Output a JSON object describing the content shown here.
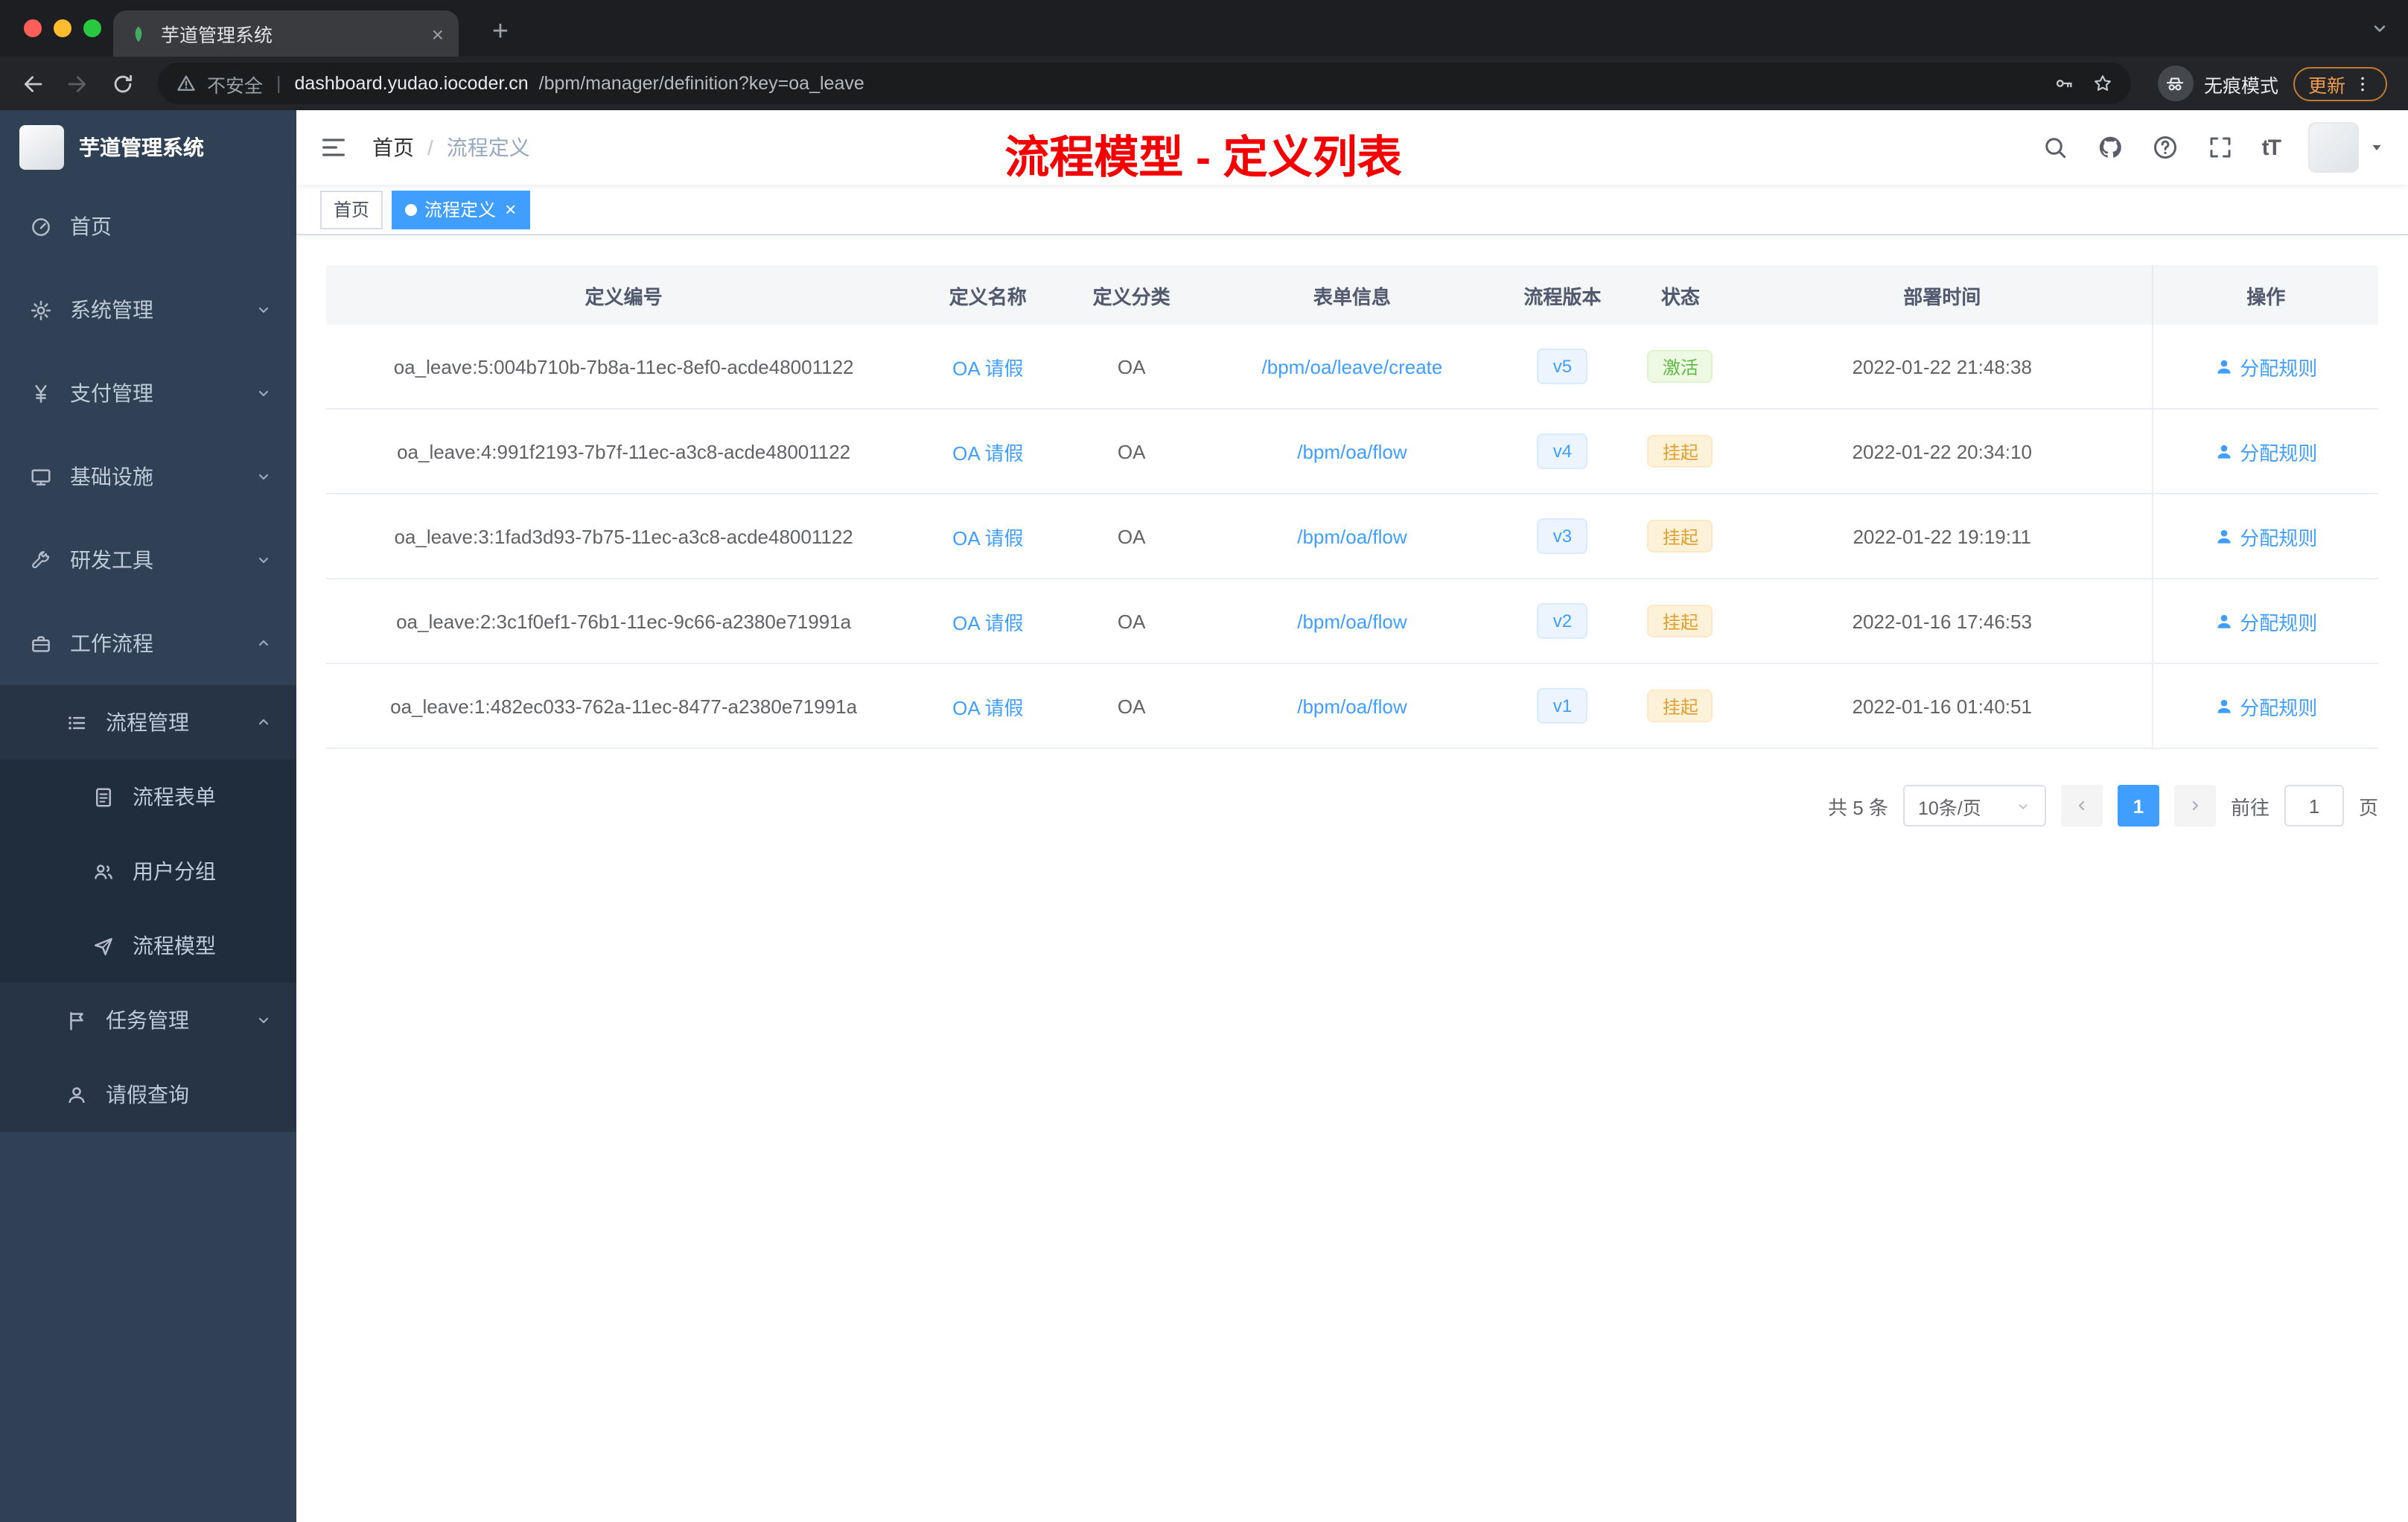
{
  "colors": {
    "accent": "#409eff",
    "success": "#67c23a",
    "warning": "#e6a23c",
    "title_red": "#f40000",
    "sidebar_bg": "#304156"
  },
  "browser": {
    "tab_title": "芋道管理系统",
    "security_text": "不安全",
    "url_domain": "dashboard.yudao.iocoder.cn",
    "url_path": "/bpm/manager/definition?key=oa_leave",
    "incognito_label": "无痕模式",
    "update_label": "更新"
  },
  "sidebar": {
    "logo_title": "芋道管理系统",
    "items": [
      {
        "key": "home",
        "label": "首页",
        "icon": "dashboard-icon",
        "level": 0
      },
      {
        "key": "system",
        "label": "系统管理",
        "icon": "gear-icon",
        "level": 0,
        "arrow": "down"
      },
      {
        "key": "payment",
        "label": "支付管理",
        "icon": "yen-icon",
        "level": 0,
        "arrow": "down"
      },
      {
        "key": "infra",
        "label": "基础设施",
        "icon": "monitor-icon",
        "level": 0,
        "arrow": "down"
      },
      {
        "key": "devtools",
        "label": "研发工具",
        "icon": "tool-icon",
        "level": 0,
        "arrow": "down"
      },
      {
        "key": "workflow",
        "label": "工作流程",
        "icon": "briefcase-icon",
        "level": 0,
        "arrow": "up"
      },
      {
        "key": "process-mgmt",
        "label": "流程管理",
        "icon": "list-icon",
        "level": 1,
        "arrow": "up"
      },
      {
        "key": "process-form",
        "label": "流程表单",
        "icon": "form-icon",
        "level": 2
      },
      {
        "key": "user-group",
        "label": "用户分组",
        "icon": "users-icon",
        "level": 2
      },
      {
        "key": "process-model",
        "label": "流程模型",
        "icon": "send-icon",
        "level": 2
      },
      {
        "key": "task-mgmt",
        "label": "任务管理",
        "icon": "flag-icon",
        "level": 1,
        "arrow": "down"
      },
      {
        "key": "leave-query",
        "label": "请假查询",
        "icon": "user-icon",
        "level": 1
      }
    ]
  },
  "header": {
    "breadcrumb": [
      "首页",
      "流程定义"
    ],
    "page_title": "流程模型 - 定义列表"
  },
  "tags": [
    {
      "label": "首页",
      "active": false,
      "closable": false
    },
    {
      "label": "流程定义",
      "active": true,
      "closable": true
    }
  ],
  "table": {
    "columns": [
      "定义编号",
      "定义名称",
      "定义分类",
      "表单信息",
      "流程版本",
      "状态",
      "部署时间",
      "操作"
    ],
    "rows": [
      {
        "id": "oa_leave:5:004b710b-7b8a-11ec-8ef0-acde48001122",
        "name": "OA 请假",
        "category": "OA",
        "form": "/bpm/oa/leave/create",
        "version": "v5",
        "status": "激活",
        "status_type": "success",
        "deploy_time": "2022-01-22 21:48:38",
        "action": "分配规则"
      },
      {
        "id": "oa_leave:4:991f2193-7b7f-11ec-a3c8-acde48001122",
        "name": "OA 请假",
        "category": "OA",
        "form": "/bpm/oa/flow",
        "version": "v4",
        "status": "挂起",
        "status_type": "warning",
        "deploy_time": "2022-01-22 20:34:10",
        "action": "分配规则"
      },
      {
        "id": "oa_leave:3:1fad3d93-7b75-11ec-a3c8-acde48001122",
        "name": "OA 请假",
        "category": "OA",
        "form": "/bpm/oa/flow",
        "version": "v3",
        "status": "挂起",
        "status_type": "warning",
        "deploy_time": "2022-01-22 19:19:11",
        "action": "分配规则"
      },
      {
        "id": "oa_leave:2:3c1f0ef1-76b1-11ec-9c66-a2380e71991a",
        "name": "OA 请假",
        "category": "OA",
        "form": "/bpm/oa/flow",
        "version": "v2",
        "status": "挂起",
        "status_type": "warning",
        "deploy_time": "2022-01-16 17:46:53",
        "action": "分配规则"
      },
      {
        "id": "oa_leave:1:482ec033-762a-11ec-8477-a2380e71991a",
        "name": "OA 请假",
        "category": "OA",
        "form": "/bpm/oa/flow",
        "version": "v1",
        "status": "挂起",
        "status_type": "warning",
        "deploy_time": "2022-01-16 01:40:51",
        "action": "分配规则"
      }
    ]
  },
  "pagination": {
    "total_text": "共 5 条",
    "page_size": "10条/页",
    "current_page": "1",
    "goto_label": "前往",
    "goto_value": "1",
    "page_suffix": "页"
  }
}
